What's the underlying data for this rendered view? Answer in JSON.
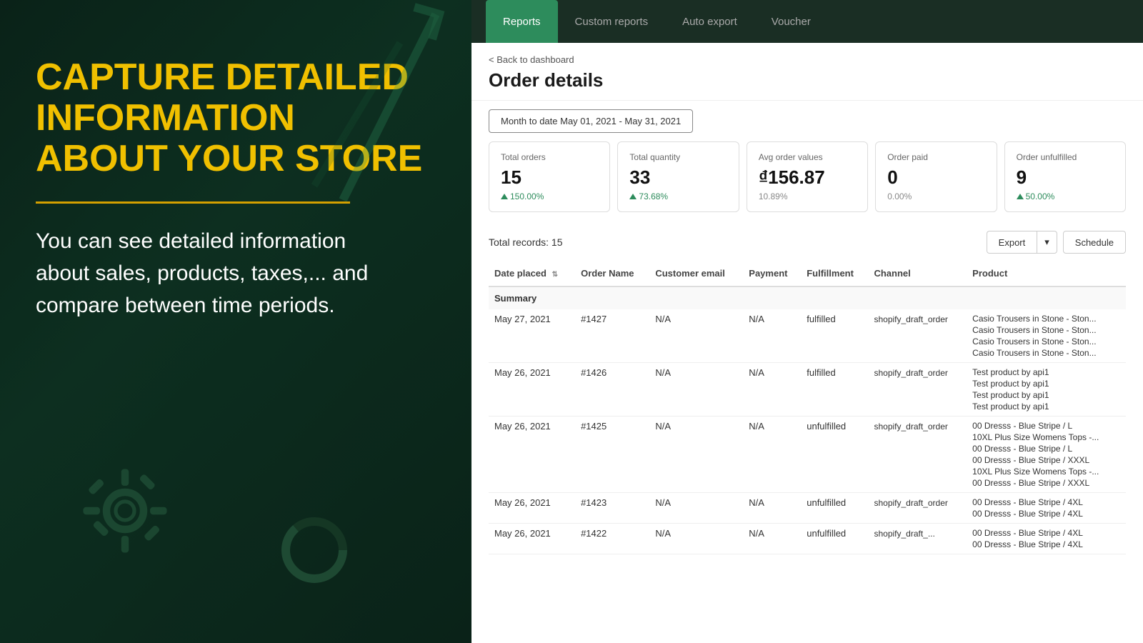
{
  "left": {
    "headline": "CAPTURE DETAILED INFORMATION ABOUT YOUR STORE",
    "subtext": "You can see detailed information about sales, products, taxes,... and compare between time periods."
  },
  "nav": {
    "tabs": [
      {
        "label": "Reports",
        "active": true
      },
      {
        "label": "Custom reports",
        "active": false
      },
      {
        "label": "Auto export",
        "active": false
      },
      {
        "label": "Voucher",
        "active": false
      }
    ]
  },
  "page": {
    "back_label": "< Back to dashboard",
    "title": "Order details",
    "date_filter": "Month to date  May 01, 2021 - May 31, 2021"
  },
  "stats": [
    {
      "label": "Total orders",
      "value": "15",
      "change": "150.00%",
      "direction": "up"
    },
    {
      "label": "Total quantity",
      "value": "33",
      "change": "73.68%",
      "direction": "up"
    },
    {
      "label": "Avg order values",
      "value": "₫156.87",
      "change": "10.89%",
      "direction": "neutral"
    },
    {
      "label": "Order paid",
      "value": "0",
      "change": "0.00%",
      "direction": "neutral"
    },
    {
      "label": "Order unfulfilled",
      "value": "9",
      "change": "50.00%",
      "direction": "up"
    }
  ],
  "table": {
    "total_records_label": "Total records: 15",
    "export_label": "Export",
    "schedule_label": "Schedule",
    "columns": [
      "Date placed",
      "Order Name",
      "Customer email",
      "Payment",
      "Fulfillment",
      "Channel",
      "Product"
    ],
    "summary_label": "Summary",
    "rows": [
      {
        "date": "May 27, 2021",
        "order_name": "#1427",
        "email": "N/A",
        "payment": "N/A",
        "fulfillment": "fulfilled",
        "channel": "shopify_draft_order",
        "products": [
          "Casio Trousers in Stone - Ston...",
          "Casio Trousers in Stone - Ston...",
          "Casio Trousers in Stone - Ston...",
          "Casio Trousers in Stone - Ston..."
        ]
      },
      {
        "date": "May 26, 2021",
        "order_name": "#1426",
        "email": "N/A",
        "payment": "N/A",
        "fulfillment": "fulfilled",
        "channel": "shopify_draft_order",
        "products": [
          "Test product by api1",
          "Test product by api1",
          "Test product by api1",
          "Test product by api1"
        ]
      },
      {
        "date": "May 26, 2021",
        "order_name": "#1425",
        "email": "N/A",
        "payment": "N/A",
        "fulfillment": "unfulfilled",
        "channel": "shopify_draft_order",
        "products": [
          "00 Dresss - Blue Stripe / L",
          "10XL Plus Size Womens Tops -...",
          "00 Dresss - Blue Stripe / L",
          "00 Dresss - Blue Stripe / XXXL",
          "10XL Plus Size Womens Tops -...",
          "00 Dresss - Blue Stripe / XXXL"
        ]
      },
      {
        "date": "May 26, 2021",
        "order_name": "#1423",
        "email": "N/A",
        "payment": "N/A",
        "fulfillment": "unfulfilled",
        "channel": "shopify_draft_order",
        "products": [
          "00 Dresss - Blue Stripe / 4XL",
          "00 Dresss - Blue Stripe / 4XL"
        ]
      },
      {
        "date": "May 26, 2021",
        "order_name": "#1422",
        "email": "N/A",
        "payment": "N/A",
        "fulfillment": "unfulfilled",
        "channel": "shopify_draft_...",
        "products": [
          "00 Dresss - Blue Stripe / 4XL",
          "00 Dresss - Blue Stripe / 4XL"
        ]
      }
    ]
  }
}
